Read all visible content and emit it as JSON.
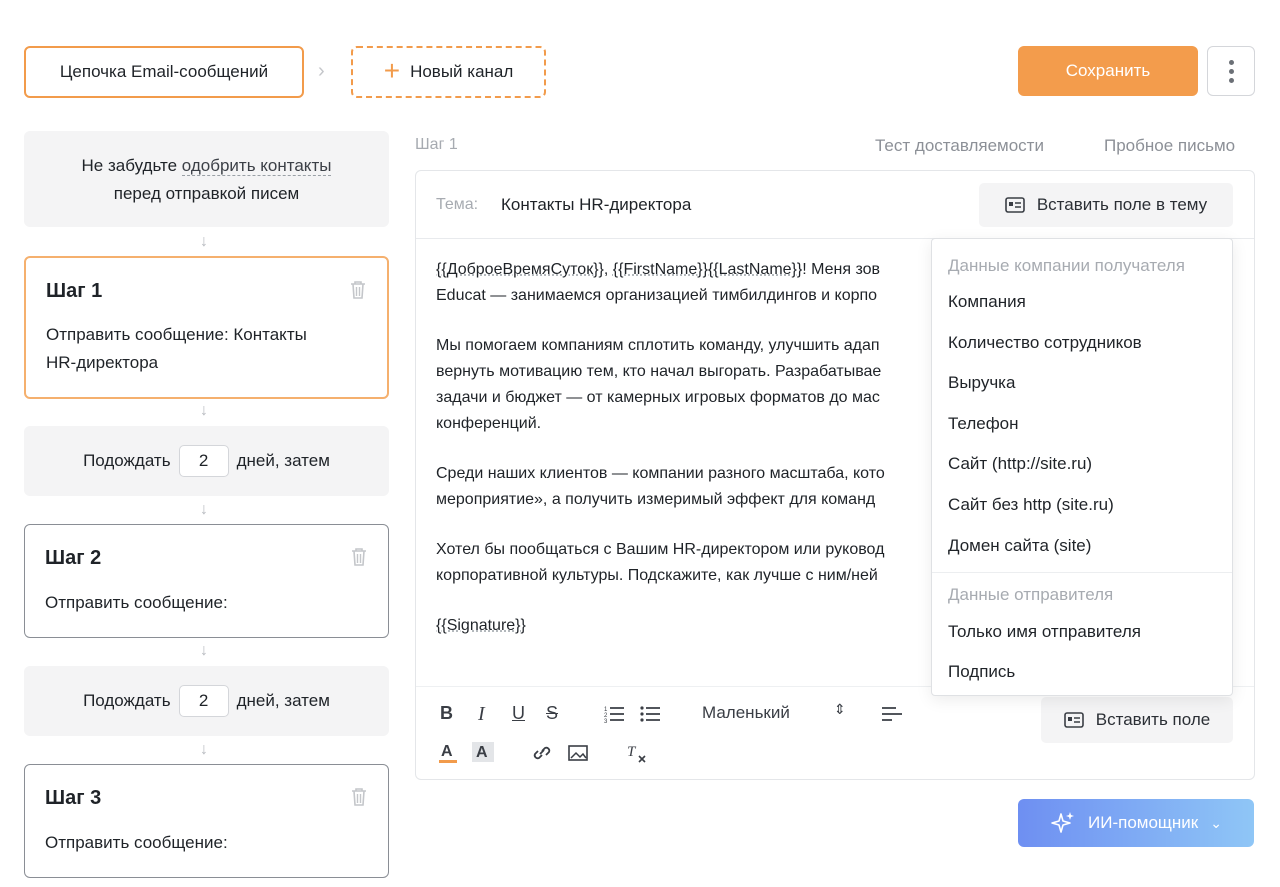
{
  "header": {
    "chain_tab": "Цепочка Email-сообщений",
    "new_channel": "Новый канал",
    "save": "Сохранить"
  },
  "reminder": {
    "prefix": "Не забудьте",
    "link": "одобрить контакты",
    "suffix": "перед отправкой писем"
  },
  "steps": [
    {
      "title": "Шаг 1",
      "text": "Отправить сообщение: Контакты",
      "text2": "HR-директора"
    },
    {
      "title": "Шаг 2",
      "text": "Отправить сообщение:"
    },
    {
      "title": "Шаг 3",
      "text": "Отправить сообщение:"
    }
  ],
  "waits": [
    {
      "before": "Подождать",
      "days": "2",
      "after": "дней, затем"
    },
    {
      "before": "Подождать",
      "days": "2",
      "after": "дней, затем"
    }
  ],
  "editor": {
    "step_label": "Шаг 1",
    "deliverability_test": "Тест доставляемости",
    "test_email": "Пробное письмо",
    "subject_label": "Тема:",
    "subject_value": "Контакты HR-директора",
    "insert_into_subject": "Вставить поле в тему",
    "body": {
      "l1_var1": "{{ДоброеВремяСуток}}",
      "l1_sep": ", ",
      "l1_var2": "{{FirstName}}{{LastName}}",
      "l1_rest": "! Меня зов",
      "l2": "Educat — занимаемся организацией тимбилдингов и корпо",
      "p2_l1": "Мы помогаем компаниям сплотить команду, улучшить адап",
      "p2_l2": "вернуть мотивацию тем, кто начал выгорать. Разрабатывае",
      "p2_l3": "задачи и бюджет — от камерных игровых форматов до мас",
      "p2_l4": "конференций.",
      "p3_l1": "Среди наших клиентов — компании разного масштаба, кото",
      "p3_l2": "мероприятие», а получить измеримый эффект для команд",
      "p4_l1": "Хотел бы пообщаться с Вашим HR-директором или руковод",
      "p4_l2": "корпоративной культуры. Подскажите, как лучше с ним/ней",
      "signature": "{{Signature}}"
    },
    "font_size": "Маленький",
    "insert_field": "Вставить поле"
  },
  "dropdown": {
    "recipient_header": "Данные компании получателя",
    "recipient_items": [
      "Компания",
      "Количество сотрудников",
      "Выручка",
      "Телефон",
      "Сайт (http://site.ru)",
      "Сайт без http (site.ru)",
      "Домен сайта (site)"
    ],
    "sender_header": "Данные отправителя",
    "sender_items": [
      "Только имя отправителя",
      "Подпись"
    ]
  },
  "ai_assistant": "ИИ-помощник",
  "colors": {
    "accent": "#f39c4c",
    "ai_gradient_start": "#6e8ff2",
    "ai_gradient_end": "#8fc6f6"
  }
}
